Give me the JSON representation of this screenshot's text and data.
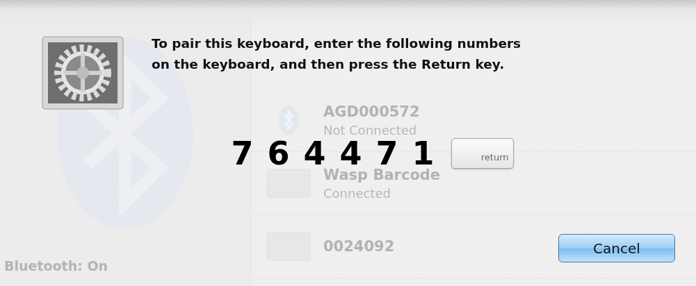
{
  "background": {
    "status": "Bluetooth: On",
    "devices": [
      {
        "name": "AGD000572",
        "status": "Not Connected",
        "kind": "bluetooth"
      },
      {
        "name": "Wasp Barcode",
        "status": "Connected",
        "kind": "generic"
      },
      {
        "name": "0024092",
        "kind": "generic"
      }
    ]
  },
  "dialog": {
    "message": "To pair this keyboard, enter the following numbers\non the keyboard, and then press the Return key.",
    "code": "7 6 4 4 7 1",
    "key_label": "return",
    "buttons": [
      {
        "label": "Cancel",
        "default": true
      }
    ]
  }
}
